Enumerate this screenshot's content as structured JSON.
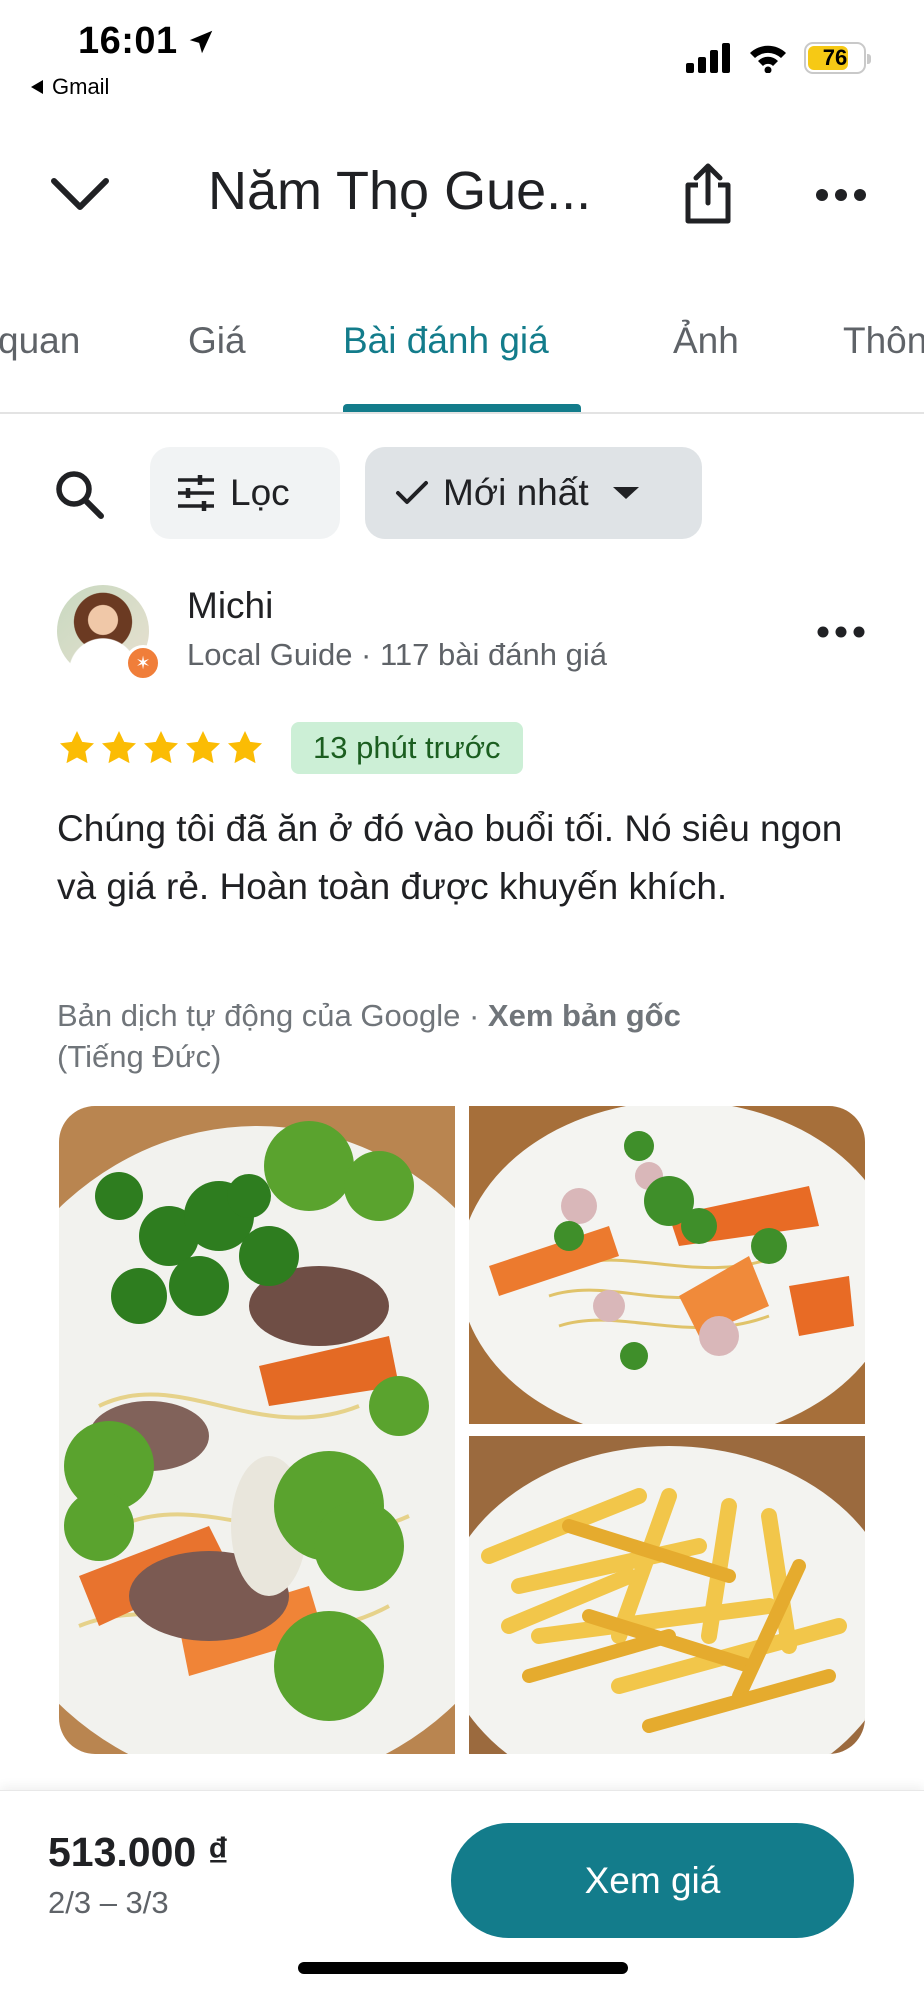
{
  "status_bar": {
    "time": "16:01",
    "back_app": "Gmail",
    "battery": "76",
    "battery_level_percent": 76,
    "icons": [
      "location-arrow-icon",
      "cellular-signal-icon",
      "wifi-icon",
      "battery-icon"
    ]
  },
  "app_bar": {
    "title": "Năm Thọ Gue...",
    "icons": [
      "chevron-down-icon",
      "share-icon",
      "more-horizontal-icon"
    ]
  },
  "tabs": [
    {
      "label": "quan",
      "active": false
    },
    {
      "label": "Giá",
      "active": false
    },
    {
      "label": "Bài đánh giá",
      "active": true
    },
    {
      "label": "Ảnh",
      "active": false
    },
    {
      "label": "Thôn",
      "active": false
    }
  ],
  "filters": {
    "filter_label": "Lọc",
    "sort_label": "Mới nhất"
  },
  "review": {
    "author": "Michi",
    "author_meta": "Local Guide · 117 bài đánh giá",
    "rating": 5,
    "rating_max": 5,
    "time_ago": "13 phút trước",
    "text": "Chúng tôi đã ăn ở đó vào buổi tối. Nó siêu ngon và giá rẻ. Hoàn toàn được khuyến khích.",
    "translation_note": "Bản dịch tự động của Google · ",
    "translation_link": "Xem bản gốc",
    "translation_language": "(Tiếng Đức)",
    "photo_count": 3
  },
  "price_bar": {
    "price": "513.000 ₫",
    "dates": "2/3 – 3/3",
    "button_label": "Xem giá"
  },
  "colors": {
    "accent": "#137c8b",
    "star": "#fbbc04",
    "time_badge_bg": "#ccefd6",
    "guide_badge": "#f07e3a"
  }
}
